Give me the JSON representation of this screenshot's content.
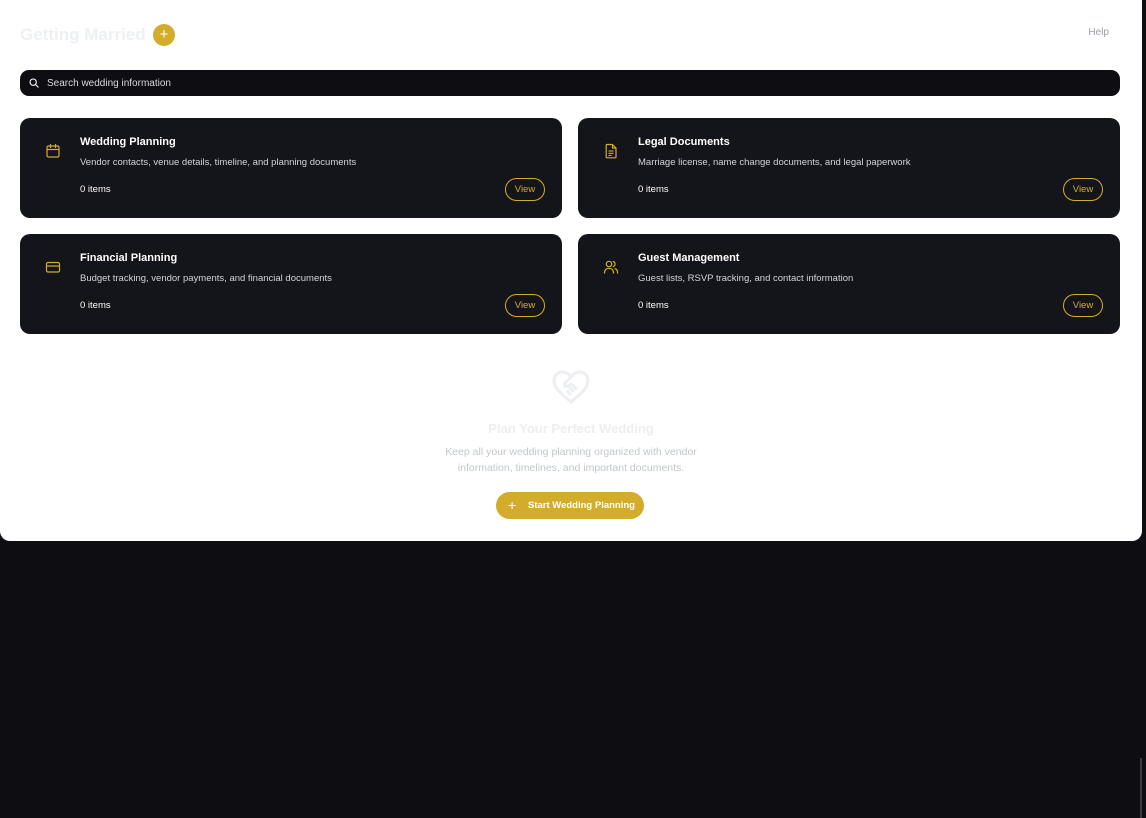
{
  "header": {
    "title": "Getting Married",
    "add_icon": "plus-icon",
    "add_glyph": "+",
    "help_label": "Help"
  },
  "search": {
    "placeholder": "Search wedding information",
    "icon": "search-icon"
  },
  "categories": [
    {
      "title": "Wedding Planning",
      "description": "Vendor contacts, venue details, timeline, and planning documents",
      "count": "0 items",
      "icon": "calendar-icon",
      "view_label": "View"
    },
    {
      "title": "Legal Documents",
      "description": "Marriage license, name change documents, and legal paperwork",
      "count": "0 items",
      "icon": "document-icon",
      "view_label": "View"
    },
    {
      "title": "Financial Planning",
      "description": "Budget tracking, vendor payments, and financial documents",
      "count": "0 items",
      "icon": "credit-card-icon",
      "view_label": "View"
    },
    {
      "title": "Guest Management",
      "description": "Guest lists, RSVP tracking, and contact information",
      "count": "0 items",
      "icon": "users-icon",
      "view_label": "View"
    }
  ],
  "empty_state": {
    "icon": "heart-handshake-icon",
    "title": "Plan Your Perfect Wedding",
    "description": "Keep all your wedding planning organized with vendor information, timelines, and important documents.",
    "button_label": "Start Wedding Planning",
    "button_icon": "plus-icon",
    "button_glyph": "+"
  },
  "colors": {
    "accent": "#d4ac2b",
    "card_bg": "#14141b",
    "page_bg": "#0d0d12"
  }
}
